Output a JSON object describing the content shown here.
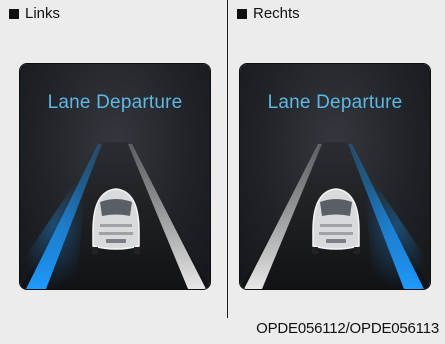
{
  "panels": {
    "left": {
      "label": "Links",
      "title": "Lane Departure",
      "warning_side": "left"
    },
    "right": {
      "label": "Rechts",
      "title": "Lane Departure",
      "warning_side": "right"
    }
  },
  "caption": "OPDE056112/OPDE056113",
  "colors": {
    "background": "#ececec",
    "title_text": "#5fb7e4",
    "warning_lane": "#1e9bff",
    "normal_lane": "#e8e8e8"
  },
  "icons": {
    "label_marker": "square-icon",
    "vehicle": "car-icon"
  }
}
